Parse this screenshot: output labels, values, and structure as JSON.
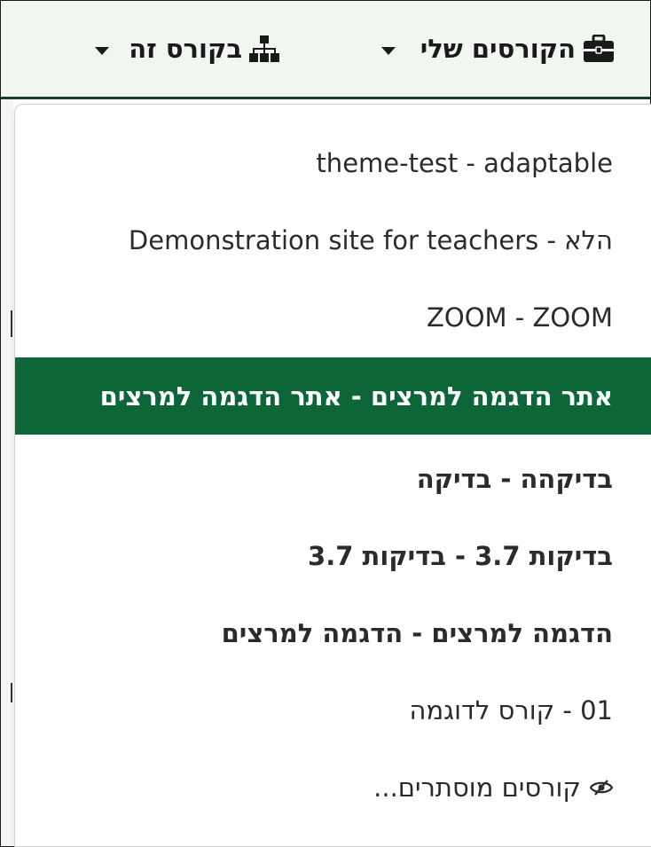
{
  "navbar": {
    "my_courses_label": "הקורסים שלי",
    "this_course_label": "בקורס זה",
    "my_courses_icon": "briefcase-icon",
    "this_course_icon": "sitemap-icon",
    "background": "#f1f6f1"
  },
  "dropdown": {
    "items": [
      {
        "label": "theme-test - adaptable",
        "active": false
      },
      {
        "label": "Demonstration site for teachers - הלא",
        "active": false
      },
      {
        "label": "ZOOM - ZOOM",
        "active": false
      },
      {
        "label": "אתר הדגמה למרצים - אתר הדגמה למרצים",
        "active": true
      },
      {
        "label": "בדיקהה - בדיקה",
        "active": false
      },
      {
        "label": "בדיקות 3.7 - בדיקות 3.7",
        "active": false
      },
      {
        "label": "הדגמה למרצים - הדגמה למרצים",
        "active": false
      },
      {
        "label": "01 - קורס לדוגמה",
        "active": false
      }
    ],
    "hidden_courses_label": "קורסים מוסתרים...",
    "hidden_courses_icon": "eye-slash-icon",
    "active_color": "#0d6637"
  }
}
